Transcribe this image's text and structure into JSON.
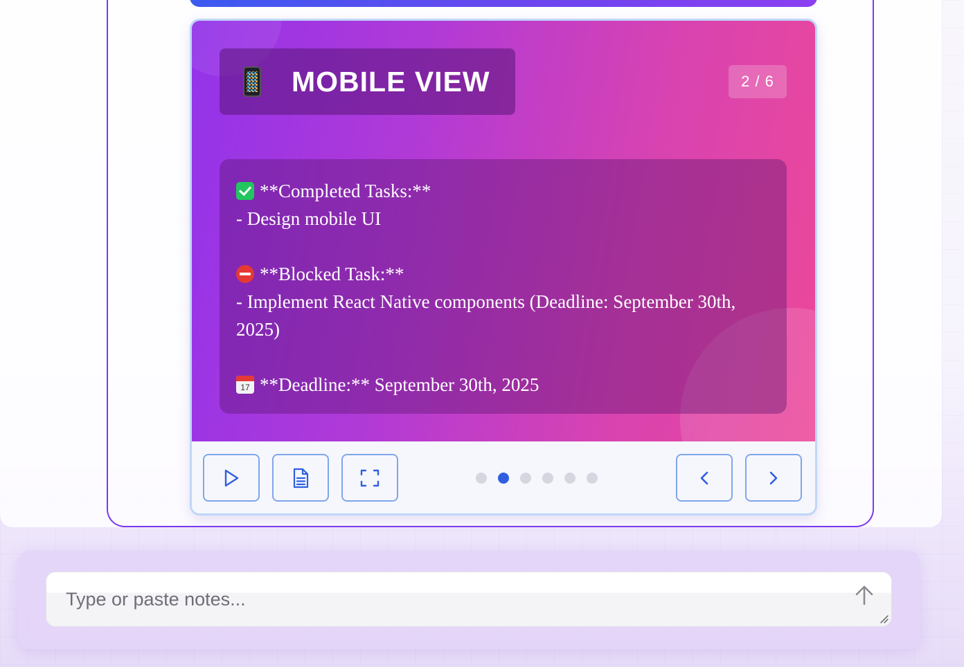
{
  "slide": {
    "title": "MOBILE VIEW",
    "counter": "2 / 6",
    "lines": [
      "**Completed Tasks:**",
      "- Design mobile UI",
      "",
      "**Blocked Task:**",
      "- Implement React Native components (Deadline: September 30th,",
      "2025)",
      "",
      "**Deadline:** September 30th, 2025"
    ],
    "calendar_day": "17"
  },
  "icons": {
    "title_icon": "mobile-phone-icon",
    "line_icons": [
      "check-mark-icon",
      "no-entry-icon",
      "calendar-icon"
    ]
  },
  "controls": {
    "buttons": [
      "play-icon",
      "document-icon",
      "fullscreen-icon"
    ],
    "nav": [
      "chevron-left-icon",
      "chevron-right-icon"
    ],
    "dots_total": 6,
    "dots_active_index": 1
  },
  "input": {
    "placeholder": "Type or paste notes...",
    "value": ""
  },
  "colors": {
    "accent": "#2f5fe0",
    "frame": "#7c3aed",
    "slide_gradient_start": "#9333ea",
    "slide_gradient_end": "#ec4899",
    "control_border": "#7fa6ec"
  }
}
